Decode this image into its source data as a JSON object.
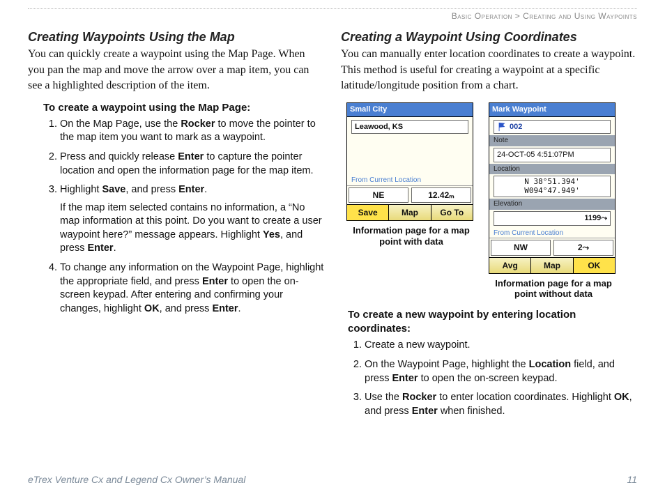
{
  "breadcrumb": {
    "section": "Basic Operation",
    "sep": ">",
    "page": "Creating and Using Waypoints"
  },
  "left": {
    "title": "Creating Waypoints Using the Map",
    "intro": "You can quickly create a waypoint using the Map Page. When you pan the map and move the arrow over a map item, you can see a highlighted description of the item.",
    "proc_title": "To create a waypoint using the Map Page:",
    "steps": {
      "s1a": "On the Map Page, use the ",
      "s1b": "Rocker",
      "s1c": " to move the pointer to the map item you want to mark as a waypoint.",
      "s2a": "Press and quickly release ",
      "s2b": "Enter",
      "s2c": " to capture the pointer location and open the information page for the map item.",
      "s3a": "Highlight ",
      "s3b": "Save",
      "s3c": ", and press ",
      "s3d": "Enter",
      "s3e": ".",
      "s3fa": "If the map item selected contains no information, a “No map information at this point. Do you want to create a user waypoint here?” message appears. Highlight ",
      "s3fb": "Yes",
      "s3fc": ", and press ",
      "s3fd": "Enter",
      "s3fe": ".",
      "s4a": "To change any information on the Waypoint Page, highlight the appropriate field, and press ",
      "s4b": "Enter",
      "s4c": " to open the on-screen keypad. After entering and confirming your changes, highlight ",
      "s4d": "OK",
      "s4e": ", and press ",
      "s4f": "Enter",
      "s4g": "."
    }
  },
  "right": {
    "title": "Creating a Waypoint Using Coordinates",
    "intro": "You can manually enter location coordinates to create a waypoint. This method is useful for creating a waypoint at a specific latitude/longitude position from a chart.",
    "dev1": {
      "title": "Small City",
      "name": "Leawood, KS",
      "from": "From Current Location",
      "dir": "NE",
      "dist": "12.42ₘ",
      "b1": "Save",
      "b2": "Map",
      "b3": "Go To",
      "caption": "Information page for a map point with data"
    },
    "dev2": {
      "title": "Mark Waypoint",
      "id": "002",
      "note_label": "Note",
      "note": "24-OCT-05 4:51:07PM",
      "loc_label": "Location",
      "loc1": "N  38°51.394'",
      "loc2": "W094°47.949'",
      "elev_label": "Elevation",
      "elev": "1199⤳",
      "from": "From Current Location",
      "dir": "NW",
      "dist": "2⤳",
      "b1": "Avg",
      "b2": "Map",
      "b3": "OK",
      "caption": "Information page for a map point without data"
    },
    "proc_title": "To create a new waypoint by entering location coordinates:",
    "steps": {
      "s1": "Create a new waypoint.",
      "s2a": "On the Waypoint Page, highlight the ",
      "s2b": "Location",
      "s2c": " field, and press ",
      "s2d": "Enter",
      "s2e": " to open the on-screen keypad.",
      "s3a": "Use the ",
      "s3b": "Rocker",
      "s3c": " to enter location coordinates. Highlight ",
      "s3d": "OK",
      "s3e": ", and press ",
      "s3f": "Enter",
      "s3g": " when finished."
    }
  },
  "footer": {
    "manual": "eTrex Venture Cx and Legend Cx Owner’s Manual",
    "page": "11"
  }
}
